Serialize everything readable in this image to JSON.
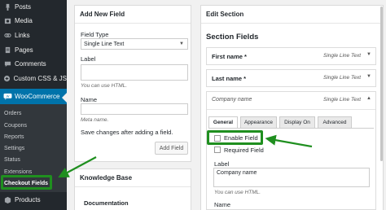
{
  "sidebar": {
    "items": [
      {
        "label": "Posts",
        "icon": "pushpin-icon"
      },
      {
        "label": "Media",
        "icon": "media-icon"
      },
      {
        "label": "Links",
        "icon": "links-icon"
      },
      {
        "label": "Pages",
        "icon": "pages-icon"
      },
      {
        "label": "Comments",
        "icon": "comment-icon"
      },
      {
        "label": "Custom CSS & JS",
        "icon": "plus-icon"
      },
      {
        "label": "WooCommerce",
        "icon": "woocommerce-icon"
      }
    ],
    "submenu": [
      "Orders",
      "Coupons",
      "Reports",
      "Settings",
      "Status",
      "Extensions",
      "Checkout Fields"
    ],
    "bottom_item": {
      "label": "Products",
      "icon": "products-icon"
    }
  },
  "add_field": {
    "title": "Add New Field",
    "field_type_label": "Field Type",
    "field_type_value": "Single Line Text",
    "label_label": "Label",
    "label_help": "You can use HTML.",
    "name_label": "Name",
    "name_help": "Meta name.",
    "save_note": "Save changes after adding a field.",
    "add_button": "Add Field"
  },
  "knowledge_base": {
    "title": "Knowledge Base",
    "doc_label": "Documentation"
  },
  "edit_section": {
    "title": "Edit Section",
    "fields_title": "Section Fields",
    "fields": [
      {
        "name": "First name *",
        "type": "Single Line Text"
      },
      {
        "name": "Last name *",
        "type": "Single Line Text"
      },
      {
        "name": "Company name",
        "type": "Single Line Text"
      }
    ],
    "tabs": [
      "General",
      "Appearance",
      "Display On",
      "Advanced"
    ],
    "enable_field": "Enable Field",
    "required_field": "Required Field",
    "label_label": "Label",
    "label_value": "Company name",
    "label_help": "You can use HTML.",
    "name_label": "Name"
  },
  "colors": {
    "highlight": "#1f8f1f",
    "accent": "#0073aa",
    "sidebar": "#23282d"
  }
}
